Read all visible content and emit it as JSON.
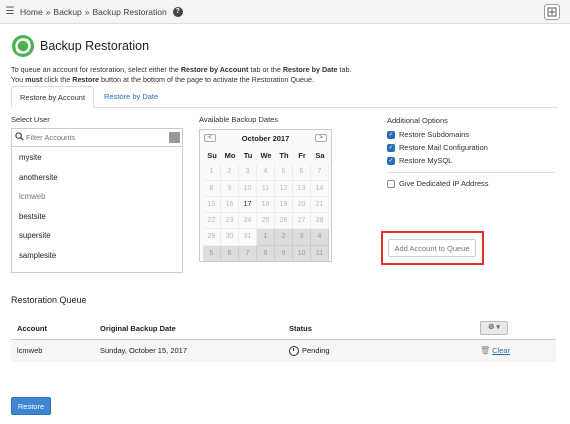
{
  "breadcrumb": {
    "home": "Home",
    "sep1": "»",
    "backup": "Backup",
    "sep2": "»",
    "current": "Backup Restoration",
    "help": "?"
  },
  "page": {
    "title": "Backup Restoration"
  },
  "intro": {
    "line1_a": "To queue an account for restoration, select either the ",
    "line1_b": "Restore by Account",
    "line1_c": " tab or the ",
    "line1_d": "Restore by Date",
    "line1_e": " tab.",
    "line2_a": "You ",
    "line2_b": "must",
    "line2_c": " click the ",
    "line2_d": "Restore",
    "line2_e": " button at the bottom of the page to activate the Restoration Queue."
  },
  "tabs": {
    "by_account": "Restore by Account",
    "by_date": "Restore by Date"
  },
  "select_user": {
    "label": "Select User",
    "placeholder": "Filter Accounts",
    "accounts": [
      "mysite",
      "anothersite",
      "lcmweb",
      "bestsite",
      "supersite",
      "samplesite"
    ]
  },
  "calendar": {
    "label": "Available Backup Dates",
    "month": "October 2017",
    "prev": "<",
    "next": ">",
    "dow": [
      "Su",
      "Mo",
      "Tu",
      "We",
      "Th",
      "Fr",
      "Sa"
    ],
    "weeks": [
      [
        "1",
        "2",
        "3",
        "4",
        "5",
        "6",
        "7"
      ],
      [
        "8",
        "9",
        "10",
        "11",
        "12",
        "13",
        "14"
      ],
      [
        "15",
        "16",
        "17",
        "18",
        "19",
        "20",
        "21"
      ],
      [
        "22",
        "23",
        "24",
        "25",
        "26",
        "27",
        "28"
      ],
      [
        "29",
        "30",
        "31",
        "1",
        "2",
        "3",
        "4"
      ],
      [
        "5",
        "6",
        "7",
        "8",
        "9",
        "10",
        "11"
      ]
    ]
  },
  "options": {
    "label": "Additional Options",
    "subdomains": "Restore Subdomains",
    "mail": "Restore Mail Configuration",
    "mysql": "Restore MySQL",
    "dedicated_ip": "Give Dedicated IP Address",
    "add_button": "Add Account to Queue"
  },
  "queue": {
    "title": "Restoration Queue",
    "headers": {
      "account": "Account",
      "date": "Original Backup Date",
      "status": "Status"
    },
    "row": {
      "account": "lcmweb",
      "date": "Sunday, October 15, 2017",
      "status": "Pending",
      "action": "Clear"
    }
  },
  "restore_button": "Restore",
  "colors": {
    "accent": "#2a6ebb",
    "button": "#3d86d1",
    "highlight": "#e0312b",
    "logo": "#4caf50"
  }
}
